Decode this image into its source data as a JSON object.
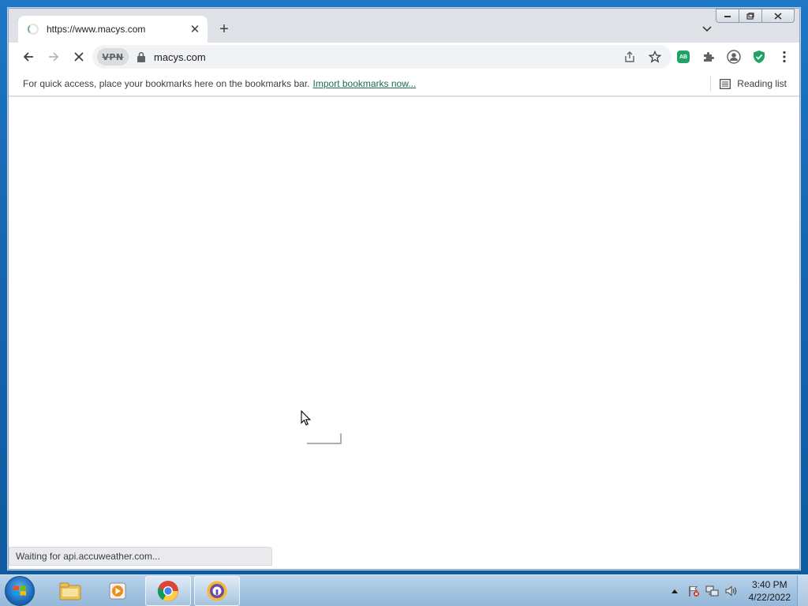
{
  "browser": {
    "tab": {
      "title": "https://www.macys.com",
      "close_glyph": "✕"
    },
    "new_tab_glyph": "+",
    "caption": {
      "minimize": "–",
      "maximize": "□",
      "close": "✕"
    },
    "toolbar": {
      "vpn_label": "VPN",
      "url": "macys.com"
    },
    "bookmarks_bar": {
      "message": "For quick access, place your bookmarks here on the bookmarks bar.",
      "import_link": "Import bookmarks now...",
      "reading_list": "Reading list"
    },
    "extensions": {
      "adblock_label": "AB"
    },
    "status_text": "Waiting for api.accuweather.com..."
  },
  "taskbar": {
    "apps": [
      {
        "name": "windows-explorer",
        "active": false
      },
      {
        "name": "media-player",
        "active": false
      },
      {
        "name": "chrome",
        "active": true
      },
      {
        "name": "vpn-client",
        "active": true
      }
    ],
    "clock": {
      "time": "3:40 PM",
      "date": "4/22/2022"
    }
  },
  "colors": {
    "accent_green": "#21a366",
    "link_color": "#1e6b4e",
    "taskbar": "#a5c4e0"
  }
}
